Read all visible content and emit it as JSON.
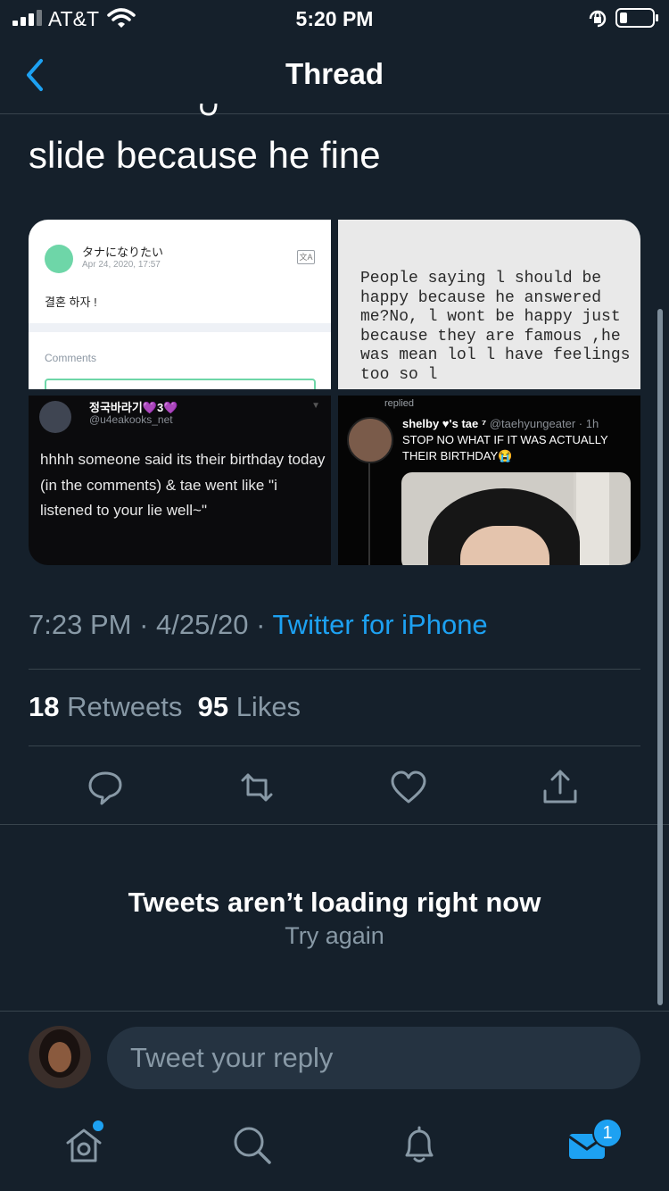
{
  "status_bar": {
    "carrier": "AT&T",
    "time": "5:20 PM"
  },
  "nav": {
    "title": "Thread"
  },
  "tweet": {
    "text": "slide because he fine",
    "media": {
      "img1": {
        "name": "タナになりたい",
        "date": "Apr 24, 2020, 17:57",
        "message": "결혼 하자 !",
        "comments_label": "Comments",
        "translate_glyph": "文A"
      },
      "img2": {
        "quote": "People saying l should be happy because he answered me?No, l wont be happy just because they are famous ,he was mean lol l have feelings too so l"
      },
      "img3": {
        "name": "정국바라기💜3💜",
        "handle": "@u4eakooks_net",
        "body": "hhhh someone said its their birthday today (in the comments) & tae went like \"i listened to your lie well~\""
      },
      "img4": {
        "replied": "replied",
        "name": "shelby ♥'s tae ⁷",
        "handle": "@taehyungeater · 1h",
        "body": "STOP NO WHAT IF IT WAS ACTUALLY THEIR BIRTHDAY😭"
      }
    },
    "time": "7:23 PM",
    "date": "4/25/20",
    "source": "Twitter for iPhone",
    "retweets_count": "18",
    "retweets_label": "Retweets",
    "likes_count": "95",
    "likes_label": "Likes"
  },
  "error": {
    "title": "Tweets aren’t loading right now",
    "retry": "Try again"
  },
  "reply": {
    "placeholder": "Tweet your reply"
  },
  "tabbar": {
    "messages_badge": "1"
  },
  "colors": {
    "background": "#15202b",
    "accent": "#1da1f2",
    "muted": "#8899a6",
    "divider": "#38444d"
  },
  "icons": [
    "signal-icon",
    "wifi-icon",
    "orientation-lock-icon",
    "battery-icon",
    "back-chevron-icon",
    "reply-icon",
    "retweet-icon",
    "like-icon",
    "share-icon",
    "home-icon",
    "search-icon",
    "notifications-icon",
    "messages-icon"
  ]
}
